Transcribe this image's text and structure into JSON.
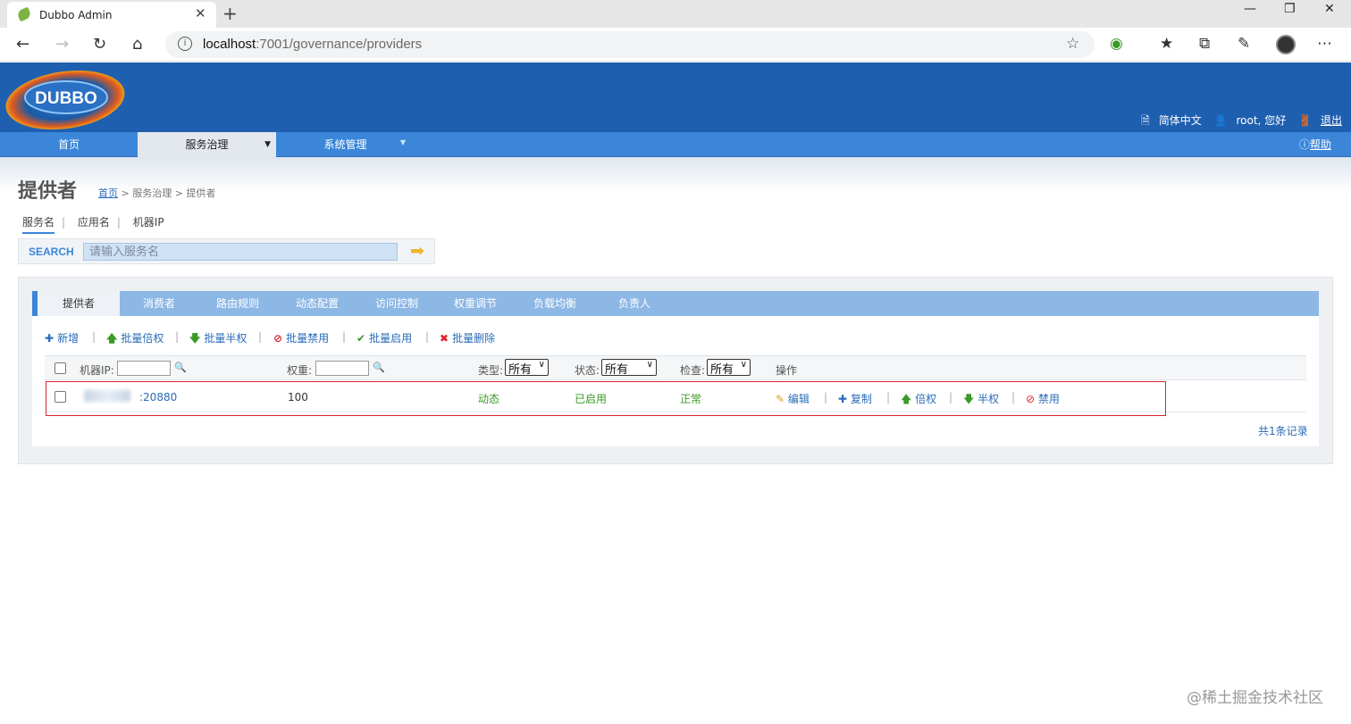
{
  "browser": {
    "tab_title": "Dubbo Admin",
    "tab_close": "✕",
    "new_tab": "+",
    "url_host": "localhost",
    "url_path": ":7001/governance/providers"
  },
  "header": {
    "logo_text": "DUBBO",
    "language_link": "简体中文",
    "user_greeting": "root, 您好",
    "logout_link": "退出",
    "help_link": "帮助"
  },
  "nav": {
    "home": "首页",
    "governance": "服务治理",
    "system": "系统管理"
  },
  "page": {
    "title": "提供者",
    "breadcrumb_home": "首页",
    "breadcrumb_rest": " > 服务治理 > 提供者"
  },
  "search": {
    "tabs": [
      "服务名",
      "应用名",
      "机器IP"
    ],
    "label": "SEARCH",
    "placeholder": "请输入服务名"
  },
  "panel_tabs": [
    "提供者",
    "消费者",
    "路由规则",
    "动态配置",
    "访问控制",
    "权重调节",
    "负载均衡",
    "负责人"
  ],
  "toolbar": {
    "add": "新增",
    "batch_double": "批量倍权",
    "batch_half": "批量半权",
    "batch_disable": "批量禁用",
    "batch_enable": "批量启用",
    "batch_delete": "批量删除"
  },
  "table": {
    "header": {
      "ip_label": "机器IP:",
      "weight_label": "权重:",
      "type_label": "类型:",
      "type_value": "所有",
      "status_label": "状态:",
      "status_value": "所有",
      "check_label": "检查:",
      "check_value": "所有",
      "actions_label": "操作"
    },
    "rows": [
      {
        "address": ":20880",
        "weight": "100",
        "type": "动态",
        "status": "已启用",
        "check": "正常",
        "actions": {
          "edit": "编辑",
          "copy": "复制",
          "double": "倍权",
          "half": "半权",
          "disable": "禁用"
        }
      }
    ],
    "records": "共1条记录"
  },
  "watermark": "@稀土掘金技术社区",
  "colors": {
    "header_blue": "#1f5fb0",
    "nav_blue": "#3b86d9",
    "link_blue": "#2a6cb8",
    "ok_green": "#3a9a27",
    "highlight_red": "#d9232d"
  }
}
